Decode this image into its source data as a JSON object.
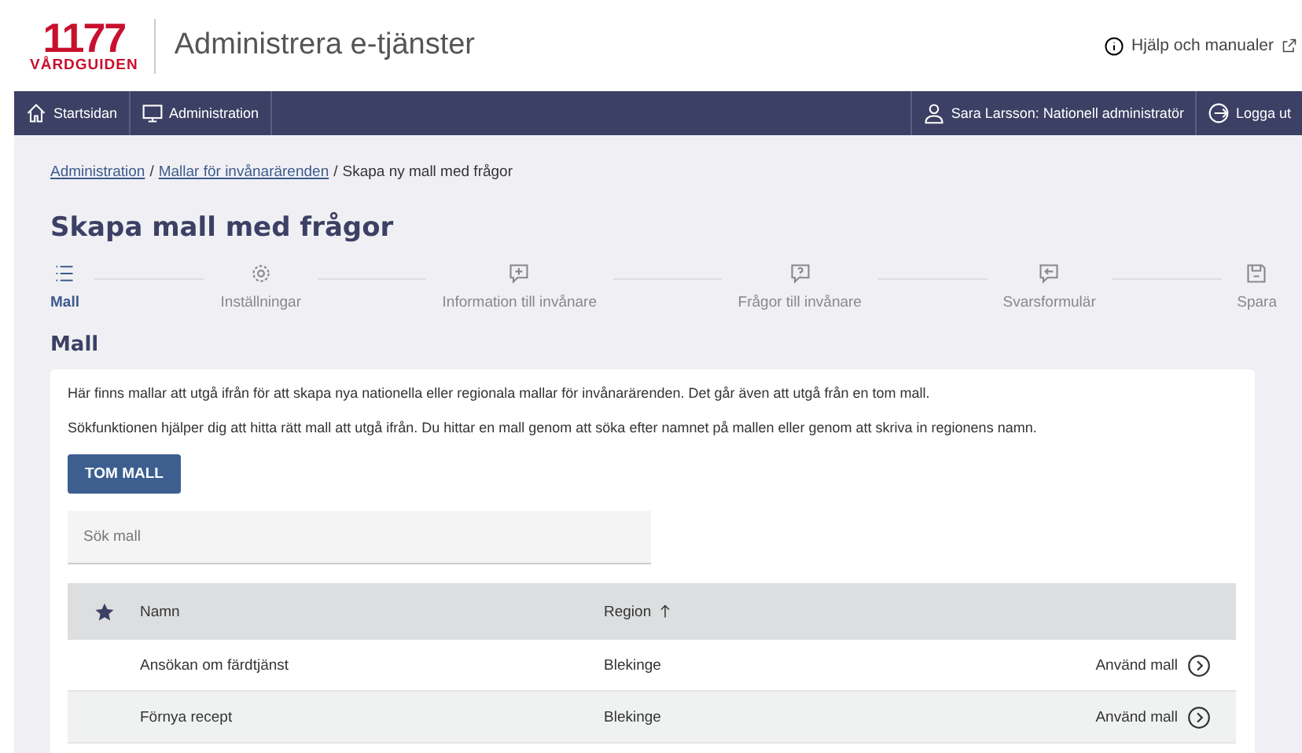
{
  "header": {
    "logo_number": "1177",
    "logo_text": "VÅRDGUIDEN",
    "title": "Administrera e-tjänster",
    "help_link": "Hjälp och manualer"
  },
  "nav": {
    "left": [
      {
        "label": "Startsidan"
      },
      {
        "label": "Administration"
      }
    ],
    "user": "Sara Larsson: Nationell administratör",
    "logout": "Logga ut"
  },
  "breadcrumb": {
    "links": [
      "Administration",
      "Mallar för invånarärenden"
    ],
    "separator": "/",
    "current": "Skapa ny mall med frågor"
  },
  "page_title": "Skapa mall med frågor",
  "steps": [
    {
      "label": "Mall",
      "selected": true
    },
    {
      "label": "Inställningar",
      "selected": false
    },
    {
      "label": "Information till invånare",
      "selected": false
    },
    {
      "label": "Frågor till invånare",
      "selected": false
    },
    {
      "label": "Svarsformulär",
      "selected": false
    },
    {
      "label": "Spara",
      "selected": false
    }
  ],
  "section_title": "Mall",
  "paragraphs": [
    "Här finns mallar att utgå ifrån för att skapa nya nationella eller regionala mallar för invånarärenden. Det går även att utgå från en tom mall.",
    "Sökfunktionen hjälper dig att hitta rätt mall att utgå ifrån. Du hittar en mall genom att söka efter namnet på mallen eller genom att skriva in regionens namn."
  ],
  "empty_button": "TOM MALL",
  "search": {
    "placeholder": "Sök mall"
  },
  "table": {
    "columns": [
      {
        "label": "Namn",
        "sorted": false
      },
      {
        "label": "Region",
        "sorted": true
      }
    ],
    "rows": [
      {
        "name": "Ansökan om färdtjänst",
        "region": "Blekinge",
        "action": "Använd mall"
      },
      {
        "name": "Förnya recept",
        "region": "Blekinge",
        "action": "Använd mall"
      }
    ]
  }
}
